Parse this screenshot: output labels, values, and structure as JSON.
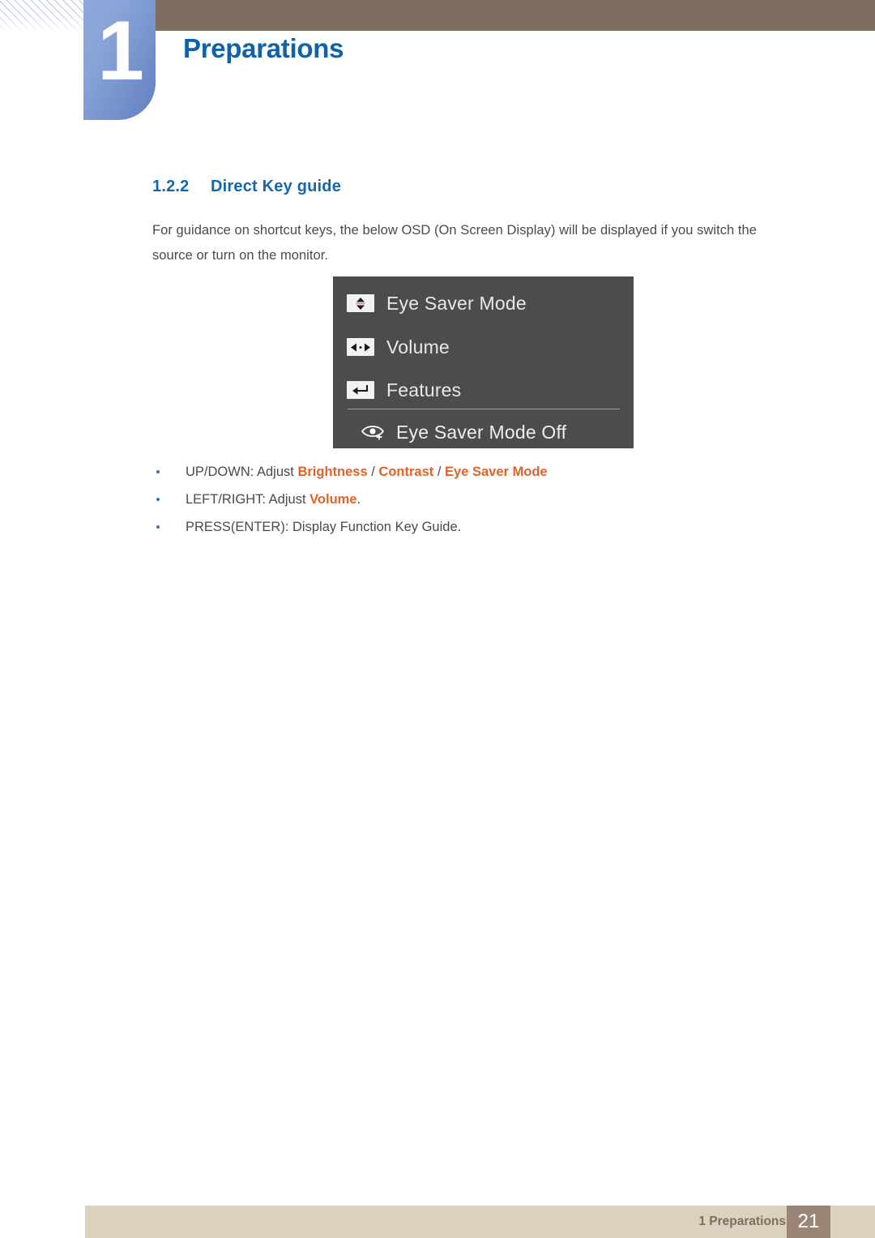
{
  "header": {
    "chapter_number": "1",
    "chapter_title": "Preparations",
    "bar_color": "#7d6e60",
    "badge_color": "#7e9ad2",
    "title_color": "#0f61a8"
  },
  "section": {
    "number": "1.2.2",
    "title": "Direct Key guide",
    "color": "#1267ad",
    "intro": "For guidance on shortcut keys, the below OSD (On Screen Display) will be displayed if you switch the source or turn on the monitor."
  },
  "osd": {
    "background": "#4c4c4c",
    "rows": [
      {
        "icon": "up-down-arrows-icon",
        "label": "Eye Saver Mode"
      },
      {
        "icon": "left-right-arrows-icon",
        "label": "Volume"
      },
      {
        "icon": "enter-return-arrow-icon",
        "label": "Features"
      }
    ],
    "status": {
      "icon": "eye-plus-icon",
      "label": "Eye Saver Mode Off"
    }
  },
  "bullets": [
    {
      "segments": [
        {
          "text": "UP/DOWN: Adjust ",
          "style": "normal"
        },
        {
          "text": "Brightness",
          "style": "keyword"
        },
        {
          "text": " / ",
          "style": "normal"
        },
        {
          "text": "Contrast",
          "style": "keyword"
        },
        {
          "text": " / ",
          "style": "normal"
        },
        {
          "text": "Eye Saver Mode",
          "style": "keyword"
        }
      ],
      "plain": "UP/DOWN: Adjust Brightness / Contrast / Eye Saver Mode"
    },
    {
      "segments": [
        {
          "text": "LEFT/RIGHT: Adjust ",
          "style": "normal"
        },
        {
          "text": "Volume",
          "style": "keyword"
        },
        {
          "text": ".",
          "style": "normal"
        }
      ],
      "plain": "LEFT/RIGHT: Adjust Volume."
    },
    {
      "segments": [
        {
          "text": "PRESS(ENTER): Display Function Key Guide.",
          "style": "normal"
        }
      ],
      "plain": "PRESS(ENTER): Display Function Key Guide."
    }
  ],
  "bullet_keyword_color": "#e2622a",
  "footer": {
    "breadcrumb": "1 Preparations",
    "page_number": "21",
    "bar_color": "#dcd0bf",
    "page_box_color": "#9a8577"
  }
}
